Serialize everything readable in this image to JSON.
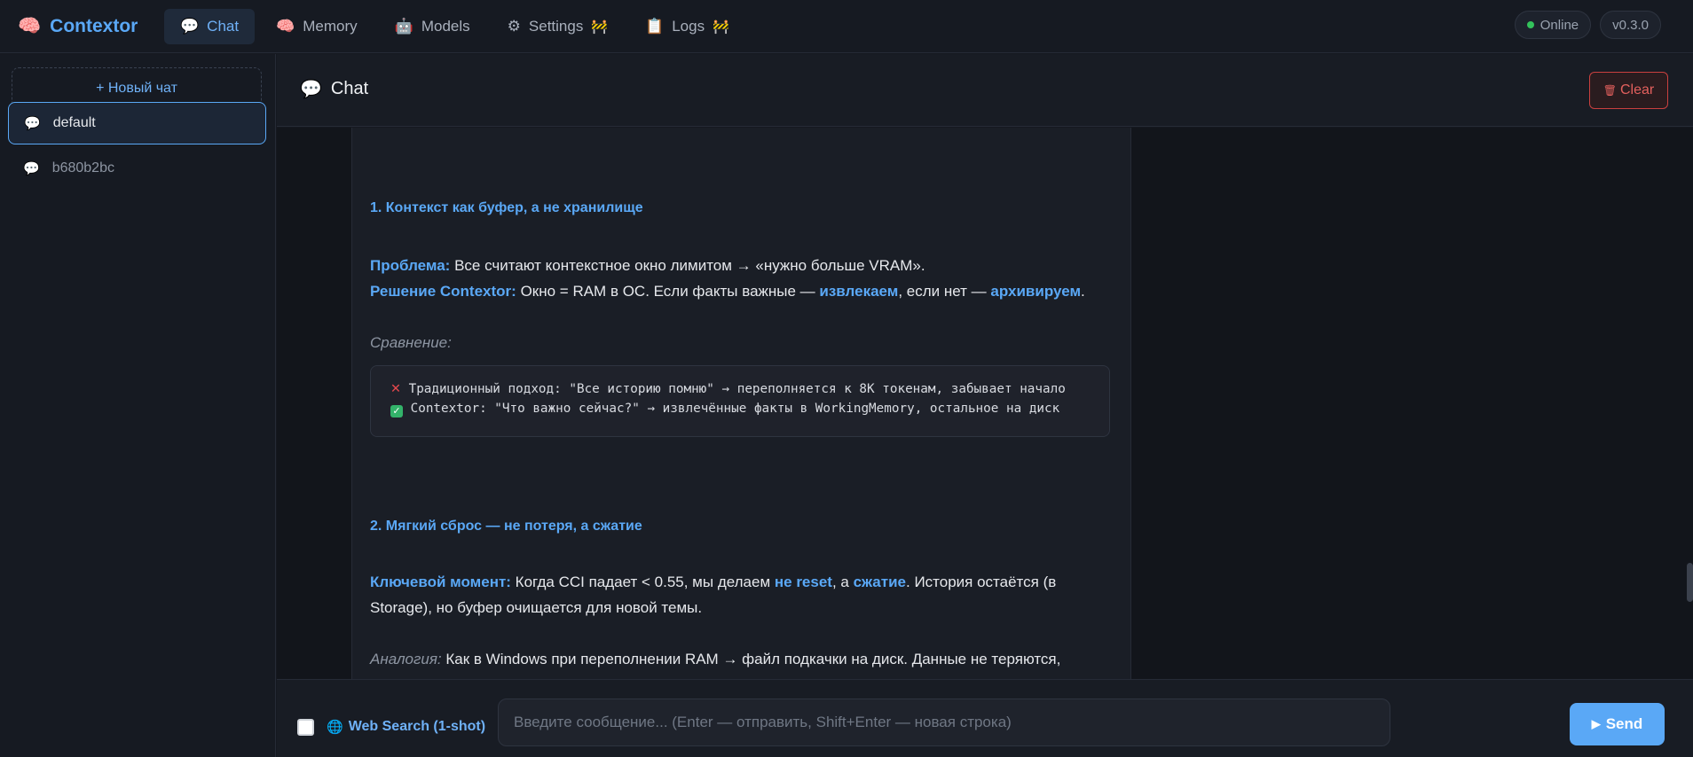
{
  "app": {
    "brand_icon": "brain-icon",
    "brand_name": "Contextor"
  },
  "nav": {
    "items": [
      {
        "icon": "speech-bubble-icon",
        "label": "Chat",
        "active": true,
        "wip": false
      },
      {
        "icon": "brain-icon",
        "label": "Memory",
        "active": false,
        "wip": false
      },
      {
        "icon": "robot-icon",
        "label": "Models",
        "active": false,
        "wip": false
      },
      {
        "icon": "gear-icon",
        "label": "Settings",
        "active": false,
        "wip": true
      },
      {
        "icon": "clipboard-icon",
        "label": "Logs",
        "active": false,
        "wip": true
      }
    ],
    "status": "Online",
    "version": "v0.3.0"
  },
  "sidebar": {
    "new_chat_label": "+ Новый чат",
    "chats": [
      {
        "icon": "speech-bubble-icon",
        "label": "default",
        "active": true
      },
      {
        "icon": "speech-bubble-icon",
        "label": "b680b2bc",
        "active": false
      }
    ]
  },
  "main": {
    "title": "Chat",
    "clear_label": "Clear"
  },
  "message": {
    "section1_heading": "1. Контекст как буфер, а не хранилище",
    "problem_label": "Проблема:",
    "problem_text": " Все считают контекстное окно лимитом → «нужно больше VRAM».",
    "solution_label": "Решение Contextor:",
    "solution_text_1": " Окно = RAM в ОС. Если факты важные — ",
    "solution_hl_1": "извлекаем",
    "solution_text_2": ", если нет — ",
    "solution_hl_2": "архивируем",
    "solution_text_3": ".",
    "comparison_label": "Сравнение:",
    "code_line_1": "Традиционный подход: \"Все историю помню\" → переполняется к 8K токенам, забывает начало",
    "code_line_2": "Contextor: \"Что важно сейчас?\" → извлечённые факты в WorkingMemory, остальное на диск",
    "section2_heading": "2. Мягкий сброс — не потеря, а сжатие",
    "key_label": "Ключевой момент:",
    "key_text_1": " Когда CCI падает < 0.55, мы делаем ",
    "key_hl_1": "не reset",
    "key_text_2": ", а ",
    "key_hl_2": "сжатие",
    "key_text_3": ". История остаётся (в Storage), но буфер очищается для новой темы.",
    "analogy_label": "Аналогия:",
    "analogy_text": " Как в Windows при переполнении RAM → файл подкачки на диск. Данные не теряются,"
  },
  "composer": {
    "web_search_icon": "globe-icon",
    "web_search_label": "Web Search (1-shot)",
    "web_search_checked": false,
    "input_placeholder": "Введите сообщение... (Enter — отправить, Shift+Enter — новая строка)",
    "input_value": "",
    "send_label": "Send"
  },
  "colors": {
    "accent": "#5aa8f6",
    "danger": "#e3605d",
    "online": "#33c25b",
    "background": "#151820"
  }
}
